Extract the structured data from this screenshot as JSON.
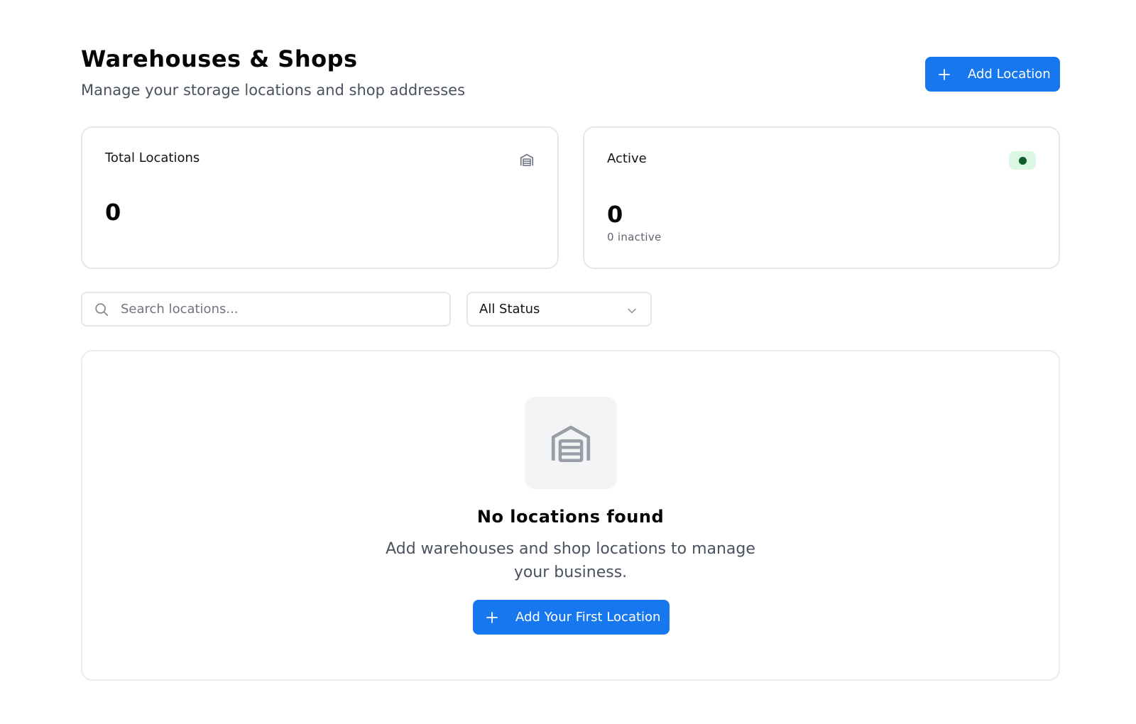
{
  "header": {
    "title": "Warehouses & Shops",
    "subtitle": "Manage your storage locations and shop addresses",
    "add_button_label": "Add Location"
  },
  "stats": {
    "total": {
      "label": "Total Locations",
      "value": "0",
      "icon": "warehouse-icon"
    },
    "active": {
      "label": "Active",
      "value": "0",
      "sub": "0 inactive",
      "status_color": "#0d5e2c"
    }
  },
  "filters": {
    "search_placeholder": "Search locations...",
    "search_value": "",
    "status_selected": "All Status"
  },
  "empty_state": {
    "icon": "warehouse-icon",
    "title": "No locations found",
    "description": "Add warehouses and shop locations to manage your business.",
    "button_label": "Add Your First Location"
  },
  "colors": {
    "accent": "#1677ee",
    "active_badge_bg": "#dcf6e4"
  }
}
